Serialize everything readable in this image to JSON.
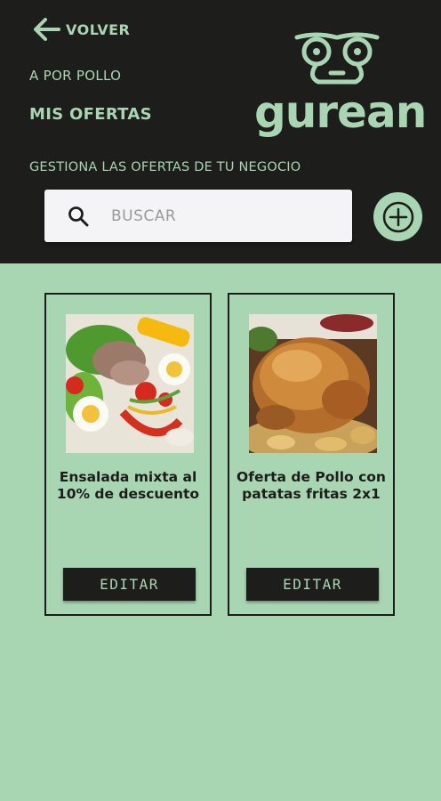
{
  "header": {
    "back_label": "VOLVER",
    "business_name": "A POR POLLO",
    "page_title": "MIS OFERTAS",
    "logo_text": "gurean",
    "subtitle": "GESTIONA LAS OFERTAS DE TU NEGOCIO"
  },
  "search": {
    "placeholder": "BUSCAR",
    "value": ""
  },
  "offers": [
    {
      "title": "Ensalada mixta al 10% de descuento",
      "edit_label": "EDITAR"
    },
    {
      "title": "Oferta de Pollo con patatas fritas 2x1",
      "edit_label": "EDITAR"
    }
  ],
  "icons": {
    "back": "arrow-left-icon",
    "search": "search-icon",
    "add": "plus-circle-icon",
    "logo": "gurean-logo-icon"
  },
  "colors": {
    "dark": "#1d1d1b",
    "accent": "#a8d5b2",
    "search_bg": "#f4f4f6"
  }
}
